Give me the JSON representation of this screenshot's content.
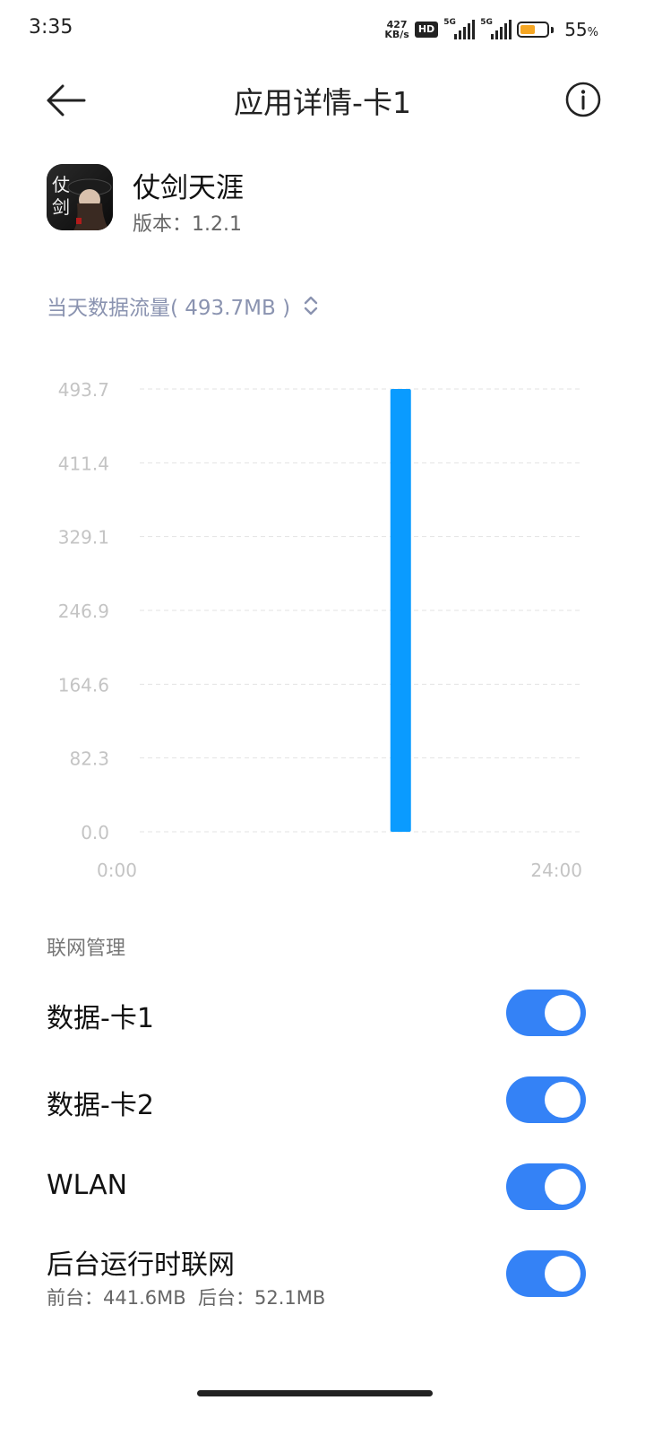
{
  "status_bar": {
    "time": "3:35",
    "net_speed_value": "427",
    "net_speed_unit": "KB/s",
    "hd_label": "HD",
    "sim1_tech": "5G",
    "sim2_tech": "5G",
    "battery_percent": "55",
    "battery_unit": "%",
    "battery_level": 0.55,
    "battery_color": "#f5a623"
  },
  "header": {
    "title": "应用详情-卡1",
    "back_icon": "arrow-left-icon",
    "info_icon": "info-circle-icon"
  },
  "app": {
    "name": "仗剑天涯",
    "version_label": "版本：",
    "version_value": "1.2.1",
    "icon_text_1": "仗",
    "icon_text_2": "剑"
  },
  "usage": {
    "selector_label": "当天数据流量( 493.7MB )",
    "selector_icon": "chevron-up-down-icon",
    "accent_color": "#8a93b0"
  },
  "chart_data": {
    "type": "bar",
    "yticks": [
      "493.7",
      "411.4",
      "329.1",
      "246.9",
      "164.6",
      "82.3",
      "0.0"
    ],
    "ylim": [
      0,
      493.7
    ],
    "x_start_label": "0:00",
    "x_end_label": "24:00",
    "xlim": [
      0,
      24
    ],
    "bars": [
      {
        "x": 14.15,
        "value": 493.7
      }
    ],
    "bar_color": "#0a9bff",
    "grid": true
  },
  "network_management": {
    "section_title": "联网管理",
    "rows": [
      {
        "label": "数据-卡1",
        "enabled": true
      },
      {
        "label": "数据-卡2",
        "enabled": true
      },
      {
        "label": "WLAN",
        "enabled": true
      },
      {
        "label": "后台运行时联网",
        "enabled": true,
        "sub": "前台：441.6MB  后台：52.1MB"
      }
    ],
    "toggle_color": "#3482f6"
  }
}
